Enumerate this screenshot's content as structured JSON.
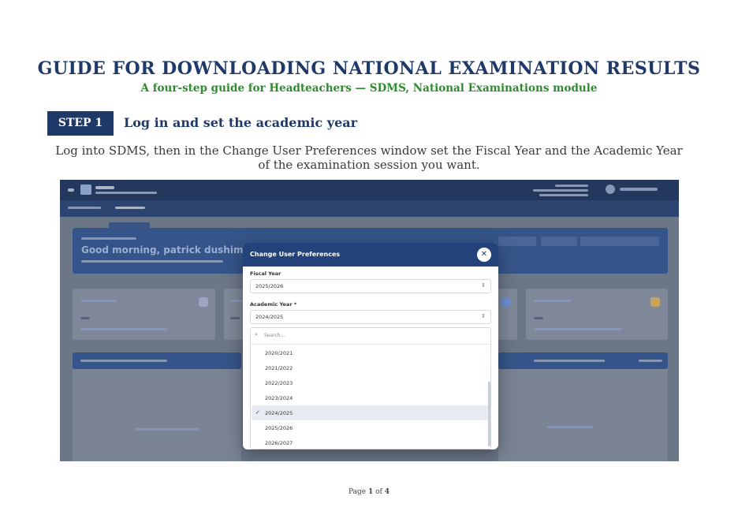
{
  "document": {
    "title": "GUIDE FOR DOWNLOADING NATIONAL EXAMINATION RESULTS",
    "subtitle": "A four-step guide for Headteachers — SDMS, National Examinations module"
  },
  "step": {
    "badge": "STEP 1",
    "title": "Log in and set the academic year",
    "instruction": "Log into SDMS, then in the Change User Preferences window set the Fiscal Year and the Academic Year of the examination session you want."
  },
  "screenshot": {
    "hero_text": "Good morning, patrick dushimimana",
    "modal": {
      "title": "Change User Preferences",
      "close_icon": "close-icon",
      "fiscal_year": {
        "label": "Fiscal Year",
        "value": "2025/2026"
      },
      "academic_year": {
        "label": "Academic Year *",
        "value": "2024/2025"
      },
      "search_placeholder": "Search...",
      "options": [
        {
          "label": "2020/2021",
          "selected": false
        },
        {
          "label": "2021/2022",
          "selected": false
        },
        {
          "label": "2022/2023",
          "selected": false
        },
        {
          "label": "2023/2024",
          "selected": false
        },
        {
          "label": "2024/2025",
          "selected": true
        },
        {
          "label": "2025/2026",
          "selected": false
        },
        {
          "label": "2026/2027",
          "selected": false
        }
      ]
    }
  },
  "footer": {
    "page_prefix": "Page",
    "current": "1",
    "separator": "of",
    "total": "4"
  }
}
